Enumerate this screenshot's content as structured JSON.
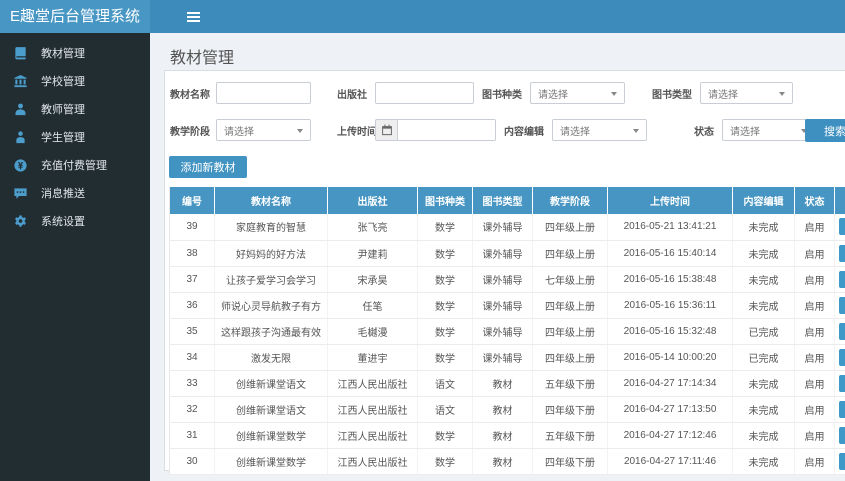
{
  "app": {
    "title": "E趣堂后台管理系统"
  },
  "colors": {
    "navbar": "#3c8bba",
    "logo": "#4796c4",
    "sidebar": "#222d32",
    "accent": "#4193c1",
    "table_header": "#4695c2",
    "icon_blue": "#4b9dcc"
  },
  "sidebar": {
    "items": [
      {
        "id": "textbook",
        "icon": "book",
        "label": "教材管理"
      },
      {
        "id": "school",
        "icon": "bank",
        "label": "学校管理"
      },
      {
        "id": "teacher",
        "icon": "teacher",
        "label": "教师管理"
      },
      {
        "id": "student",
        "icon": "student",
        "label": "学生管理"
      },
      {
        "id": "payment",
        "icon": "money",
        "label": "充值付费管理"
      },
      {
        "id": "message",
        "icon": "comment",
        "label": "消息推送"
      },
      {
        "id": "settings",
        "icon": "gear",
        "label": "系统设置"
      }
    ]
  },
  "page": {
    "title": "教材管理"
  },
  "filters": {
    "rows": [
      [
        {
          "id": "name",
          "label": "教材名称",
          "type": "text",
          "value": ""
        },
        {
          "id": "publisher",
          "label": "出版社",
          "type": "text",
          "value": ""
        },
        {
          "id": "book-kind",
          "label": "图书种类",
          "type": "select",
          "value": "请选择"
        },
        {
          "id": "book-type",
          "label": "图书类型",
          "type": "select",
          "value": "请选择"
        }
      ],
      [
        {
          "id": "stage",
          "label": "教学阶段",
          "type": "select",
          "value": "请选择"
        },
        {
          "id": "upload-time",
          "label": "上传时间",
          "type": "date",
          "value": ""
        },
        {
          "id": "editor",
          "label": "内容编辑",
          "type": "select",
          "value": "请选择"
        },
        {
          "id": "status",
          "label": "状态",
          "type": "select",
          "value": "请选择"
        }
      ]
    ],
    "search_label": "搜索"
  },
  "toolbar": {
    "add_label": "添加新教材"
  },
  "table": {
    "headers": [
      "编号",
      "教材名称",
      "出版社",
      "图书种类",
      "图书类型",
      "教学阶段",
      "上传时间",
      "内容编辑",
      "状态",
      ""
    ],
    "rows": [
      [
        "39",
        "家庭教育的智慧",
        "张飞亮",
        "数学",
        "课外辅导",
        "四年级上册",
        "2016-05-21 13:41:21",
        "未完成",
        "启用"
      ],
      [
        "38",
        "好妈妈的好方法",
        "尹建莉",
        "数学",
        "课外辅导",
        "四年级上册",
        "2016-05-16 15:40:14",
        "未完成",
        "启用"
      ],
      [
        "37",
        "让孩子爱学习会学习",
        "宋承昊",
        "数学",
        "课外辅导",
        "七年级上册",
        "2016-05-16 15:38:48",
        "未完成",
        "启用"
      ],
      [
        "36",
        "师说心灵导航教子有方",
        "任笔",
        "数学",
        "课外辅导",
        "四年级上册",
        "2016-05-16 15:36:11",
        "未完成",
        "启用"
      ],
      [
        "35",
        "这样跟孩子沟通最有效",
        "毛樾漫",
        "数学",
        "课外辅导",
        "四年级上册",
        "2016-05-16 15:32:48",
        "已完成",
        "启用"
      ],
      [
        "34",
        "激发无限",
        "董进宇",
        "数学",
        "课外辅导",
        "四年级上册",
        "2016-05-14 10:00:20",
        "已完成",
        "启用"
      ],
      [
        "33",
        "创维新课堂语文",
        "江西人民出版社",
        "语文",
        "教材",
        "五年级下册",
        "2016-04-27 17:14:34",
        "未完成",
        "启用"
      ],
      [
        "32",
        "创维新课堂语文",
        "江西人民出版社",
        "语文",
        "教材",
        "四年级下册",
        "2016-04-27 17:13:50",
        "未完成",
        "启用"
      ],
      [
        "31",
        "创维新课堂数学",
        "江西人民出版社",
        "数学",
        "教材",
        "五年级下册",
        "2016-04-27 17:12:46",
        "未完成",
        "启用"
      ],
      [
        "30",
        "创维新课堂数学",
        "江西人民出版社",
        "数学",
        "教材",
        "四年级下册",
        "2016-04-27 17:11:46",
        "未完成",
        "启用"
      ]
    ]
  }
}
